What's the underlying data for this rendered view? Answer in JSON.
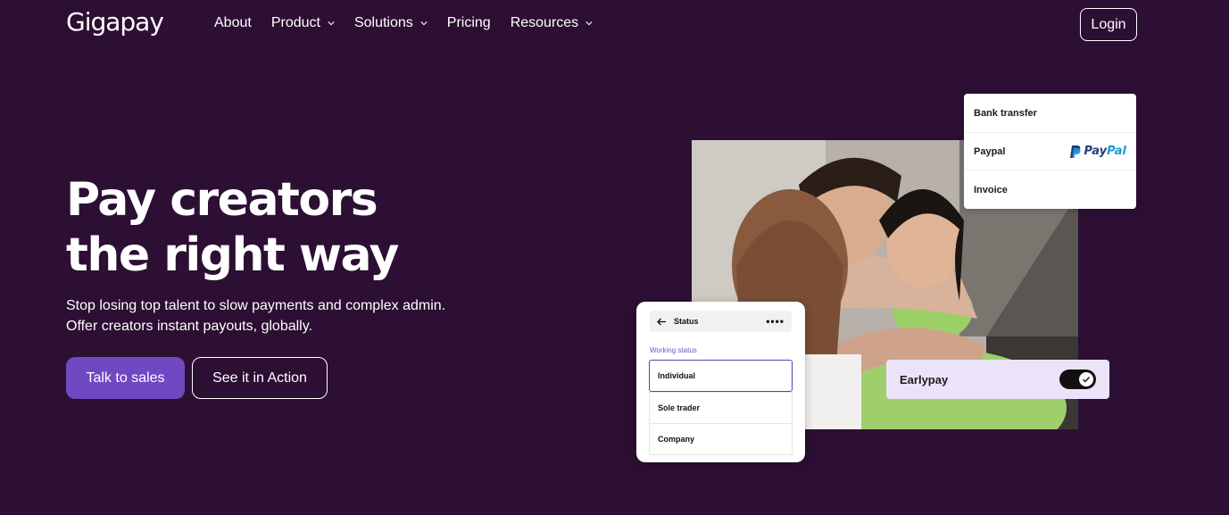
{
  "header": {
    "logo": "Gigapay",
    "nav": [
      {
        "label": "About",
        "has_dropdown": false
      },
      {
        "label": "Product",
        "has_dropdown": true
      },
      {
        "label": "Solutions",
        "has_dropdown": true
      },
      {
        "label": "Pricing",
        "has_dropdown": false
      },
      {
        "label": "Resources",
        "has_dropdown": true
      }
    ],
    "login_label": "Login"
  },
  "hero": {
    "headline_line1": "Pay creators",
    "headline_line2": "the right way",
    "sub_line1": "Stop losing top talent to slow payments and complex admin.",
    "sub_line2": "Offer creators instant payouts, globally.",
    "primary_cta": "Talk to sales",
    "secondary_cta": "See it in Action"
  },
  "payment_card": {
    "rows": [
      "Bank transfer",
      "Paypal",
      "Invoice"
    ],
    "paypal_logo_a": "Pay",
    "paypal_logo_b": "Pal"
  },
  "status_card": {
    "title": "Status",
    "field_label": "Working status",
    "options": [
      "Individual",
      "Sole trader",
      "Company"
    ],
    "selected": "Individual"
  },
  "earlypay": {
    "label": "Earlypay",
    "enabled": true
  },
  "colors": {
    "background": "#2c0f33",
    "primary_button": "#7048c2",
    "earlypay_bg": "#ece3fb"
  }
}
